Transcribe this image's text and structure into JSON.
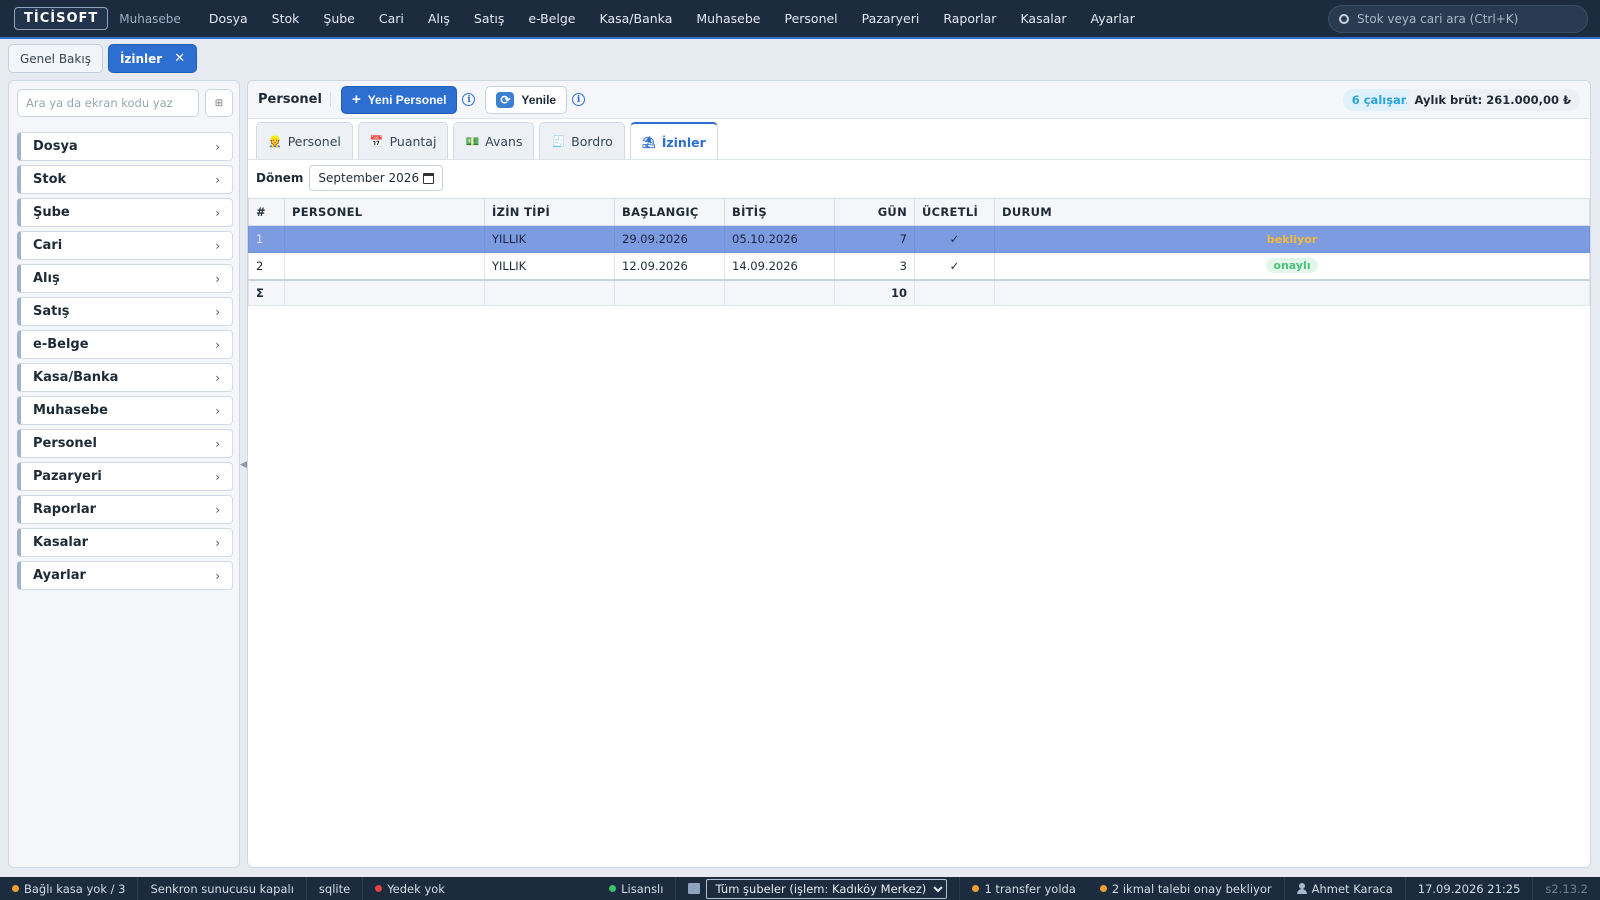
{
  "app": {
    "logo": "TİCİSOFT",
    "module": "Muhasebe"
  },
  "topmenu": [
    "Dosya",
    "Stok",
    "Şube",
    "Cari",
    "Alış",
    "Satış",
    "e-Belge",
    "Kasa/Banka",
    "Muhasebe",
    "Personel",
    "Pazaryeri",
    "Raporlar",
    "Kasalar",
    "Ayarlar"
  ],
  "search": {
    "placeholder": "Stok veya cari ara (Ctrl+K)"
  },
  "window_tabs": [
    {
      "label": "Genel Bakış",
      "active": false
    },
    {
      "label": "İzinler",
      "active": true,
      "close": "✕"
    }
  ],
  "sidebar": {
    "search_placeholder": "Ara ya da ekran kodu yaz",
    "grid_button": "⊞",
    "items": [
      "Dosya",
      "Stok",
      "Şube",
      "Cari",
      "Alış",
      "Satış",
      "e-Belge",
      "Kasa/Banka",
      "Muhasebe",
      "Personel",
      "Pazaryeri",
      "Raporlar",
      "Kasalar",
      "Ayarlar"
    ],
    "chevron": "›"
  },
  "toolbar": {
    "title": "Personel",
    "new_label": "Yeni Personel",
    "refresh_label": "Yenile",
    "info": "i",
    "employee_count": "6 çalışan",
    "monthly_gross": "Aylık brüt: 261.000,00 ₺"
  },
  "module_tabs": [
    {
      "label": "Personel",
      "icon": "person-icon",
      "glyph": "👷",
      "active": false
    },
    {
      "label": "Puantaj",
      "icon": "calendar-icon",
      "glyph": "📅",
      "active": false
    },
    {
      "label": "Avans",
      "icon": "money-icon",
      "glyph": "💵",
      "active": false
    },
    {
      "label": "Bordro",
      "icon": "receipt-icon",
      "glyph": "🧾",
      "active": false
    },
    {
      "label": "İzinler",
      "icon": "beach-icon",
      "glyph": "⛱",
      "active": true
    }
  ],
  "filter": {
    "label": "Dönem",
    "value": "September 2026"
  },
  "table": {
    "columns": [
      "#",
      "PERSONEL",
      "İZİN TİPİ",
      "BAŞLANGIÇ",
      "BİTİŞ",
      "GÜN",
      "ÜCRETLİ",
      "DURUM"
    ],
    "rows": [
      {
        "no": "1",
        "personel": "",
        "tip": "YILLIK",
        "baslangic": "29.09.2026",
        "bitis": "05.10.2026",
        "gun": "7",
        "ucretli": "✓",
        "durum": "bekliyor",
        "selected": true
      },
      {
        "no": "2",
        "personel": "",
        "tip": "YILLIK",
        "baslangic": "12.09.2026",
        "bitis": "14.09.2026",
        "gun": "3",
        "ucretli": "✓",
        "durum": "onaylı",
        "selected": false
      }
    ],
    "sum_symbol": "Σ",
    "sum_gun": "10"
  },
  "statusbar": {
    "kasa": "Bağlı kasa yok / 3",
    "sync": "Senkron sunucusu kapalı",
    "db": "sqlite",
    "backup": "Yedek yok",
    "license": "Lisanslı",
    "branch": "Tüm şubeler (işlem: Kadıköy Merkez)",
    "transfer": "1 transfer yolda",
    "ikmal": "2 ikmal talebi onay bekliyor",
    "user": "Ahmet Karaca",
    "datetime": "17.09.2026 21:25",
    "version": "s2.13.2"
  },
  "colors": {
    "accent": "#2c6fd1",
    "topbar": "#1c2b3e",
    "selected_row": "#7d9be0",
    "waiting": "#f4b93a",
    "approved": "#49c27a"
  }
}
